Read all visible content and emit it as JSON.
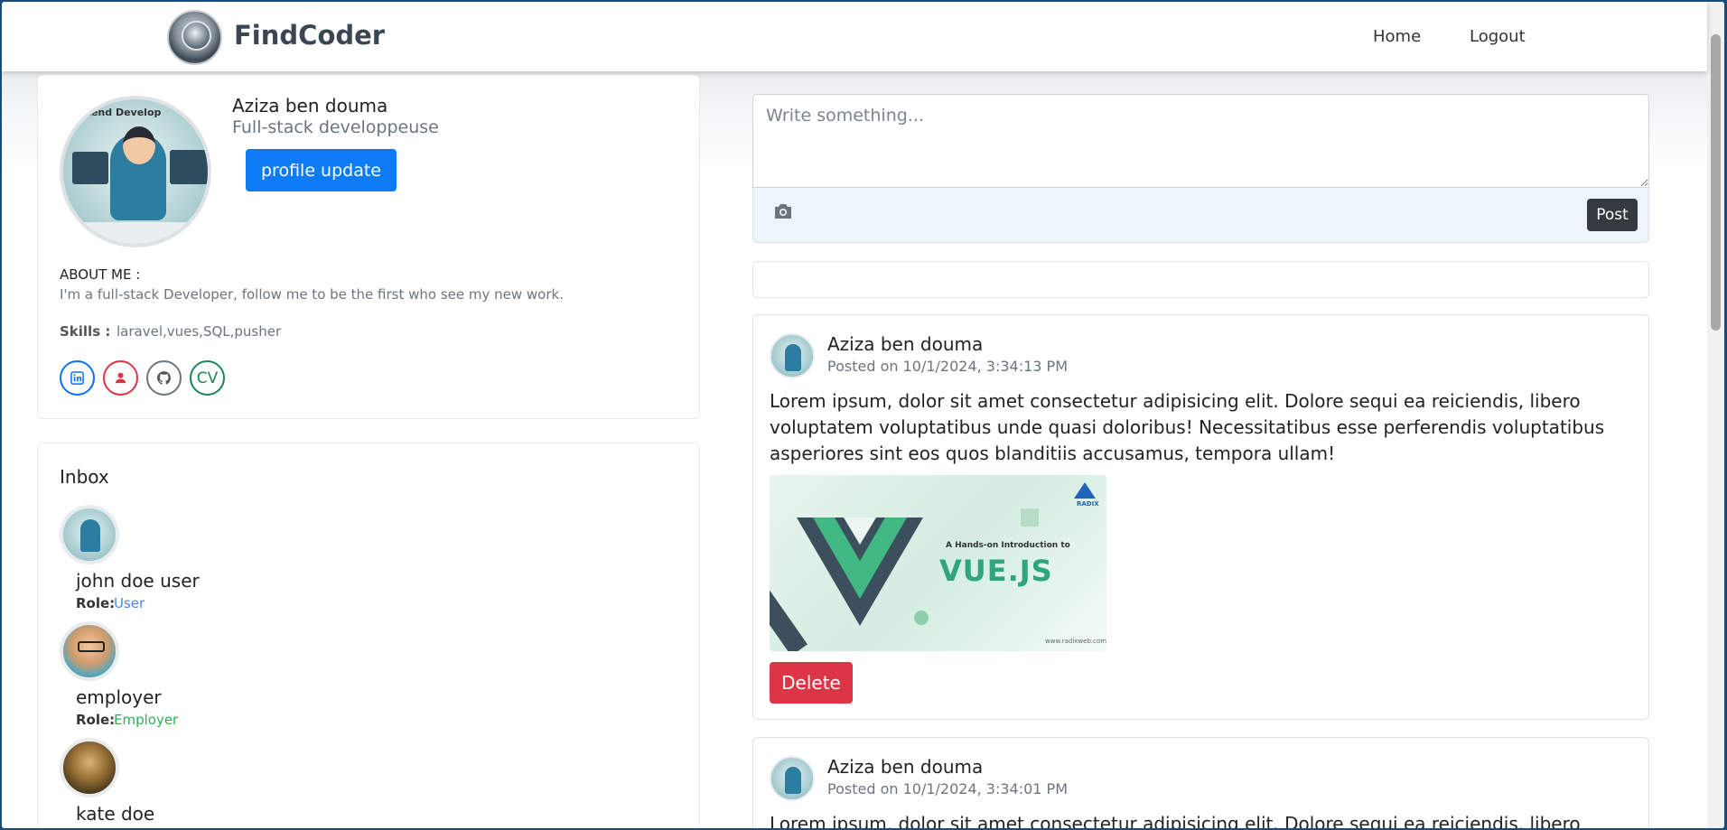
{
  "navbar": {
    "brand": "FindCoder",
    "logo_icon": "findcoder-logo",
    "links": {
      "home": "Home",
      "logout": "Logout"
    }
  },
  "profile": {
    "name": "Aziza ben douma",
    "title": "Full-stack developpeuse",
    "update_button": "profile update",
    "about_label": "ABOUT ME :",
    "about_text": "I'm a full-stack Developer, follow me to be the first who see my new work.",
    "skills_label": "Skills :",
    "skills_value": "laravel,vues,SQL,pusher",
    "avatar_text": "ackend Develop",
    "social": {
      "linkedin_icon": "linkedin-icon",
      "profile_icon": "person-icon",
      "github_icon": "github-icon",
      "cv_label": "CV"
    }
  },
  "inbox": {
    "title": "Inbox",
    "role_label": "Role:",
    "items": [
      {
        "name": "john doe user",
        "role": "User",
        "role_color": "#4a86e8"
      },
      {
        "name": "employer",
        "role": "Employer",
        "role_color": "#2eae5a"
      },
      {
        "name": "kate doe",
        "role": "",
        "role_color": "#333333"
      }
    ]
  },
  "composer": {
    "placeholder": "Write something...",
    "camera_icon": "camera-icon",
    "post_button": "Post"
  },
  "posts": [
    {
      "author": "Aziza ben douma",
      "date": "Posted on 10/1/2024, 3:34:13 PM",
      "body": "Lorem ipsum, dolor sit amet consectetur adipisicing elit. Dolore sequi ea reiciendis, libero voluptatem voluptatibus unde quasi doloribus! Necessitatibus esse perferendis voluptatibus asperiores sint eos quos blanditiis accusamus, tempora ullam!",
      "image": {
        "subtitle": "A Hands-on Introduction to",
        "title": "VUE.JS",
        "badge": "RADIX",
        "url": "www.radixweb.com"
      },
      "delete_button": "Delete"
    },
    {
      "author": "Aziza ben douma",
      "date": "Posted on 10/1/2024, 3:34:01 PM",
      "body": "Lorem ipsum, dolor sit amet consectetur adipisicing elit. Dolore sequi ea reiciendis, libero"
    }
  ],
  "colors": {
    "primary": "#0d7bf5",
    "danger": "#dc3545",
    "dark": "#343a40",
    "brand_text": "#3b4652"
  }
}
